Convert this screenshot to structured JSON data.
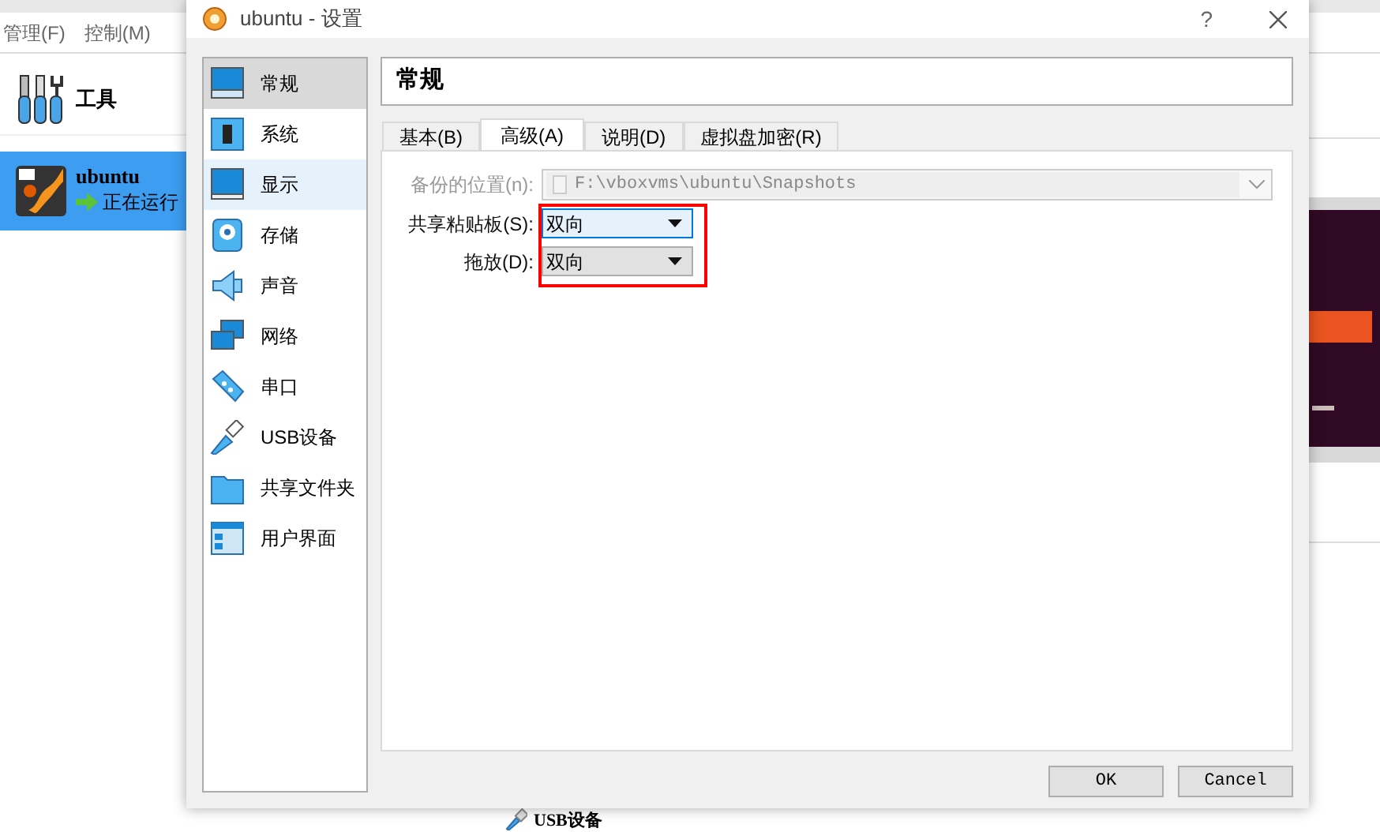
{
  "main_window": {
    "menu": [
      "管理(F)",
      "控制(M)"
    ],
    "machines": [
      {
        "kind": "tools",
        "name": "工具",
        "selected": false
      },
      {
        "kind": "vm",
        "name": "ubuntu",
        "status": "正在运行",
        "selected": true
      }
    ],
    "details": {
      "section_title": "USB设备"
    }
  },
  "dialog": {
    "title": "ubuntu - 设置",
    "help": "?",
    "sidebar": [
      {
        "label": "常规",
        "selected": true,
        "hovered": false
      },
      {
        "label": "系统",
        "selected": false,
        "hovered": false
      },
      {
        "label": "显示",
        "selected": false,
        "hovered": true
      },
      {
        "label": "存储",
        "selected": false,
        "hovered": false
      },
      {
        "label": "声音",
        "selected": false,
        "hovered": false
      },
      {
        "label": "网络",
        "selected": false,
        "hovered": false
      },
      {
        "label": "串口",
        "selected": false,
        "hovered": false
      },
      {
        "label": "USB设备",
        "selected": false,
        "hovered": false
      },
      {
        "label": "共享文件夹",
        "selected": false,
        "hovered": false
      },
      {
        "label": "用户界面",
        "selected": false,
        "hovered": false
      }
    ],
    "highlight_frame": true,
    "header": "常规",
    "tabs": [
      {
        "label": "基本(B)",
        "selected": false
      },
      {
        "label": "高级(A)",
        "selected": true
      },
      {
        "label": "说明(D)",
        "selected": false
      },
      {
        "label": "虚拟盘加密(R)",
        "selected": false
      }
    ],
    "fields": [
      {
        "kind": "path",
        "label": "备份的位置(n):",
        "value": "F:\\vboxvms\\ubuntu\\Snapshots",
        "disabled": true
      },
      {
        "kind": "combo",
        "label": "共享粘贴板(S):",
        "value": "双向",
        "focused": true
      },
      {
        "kind": "combo",
        "label": "拖放(D):",
        "value": "双向",
        "focused": false
      }
    ],
    "buttons": [
      "OK",
      "Cancel"
    ]
  }
}
